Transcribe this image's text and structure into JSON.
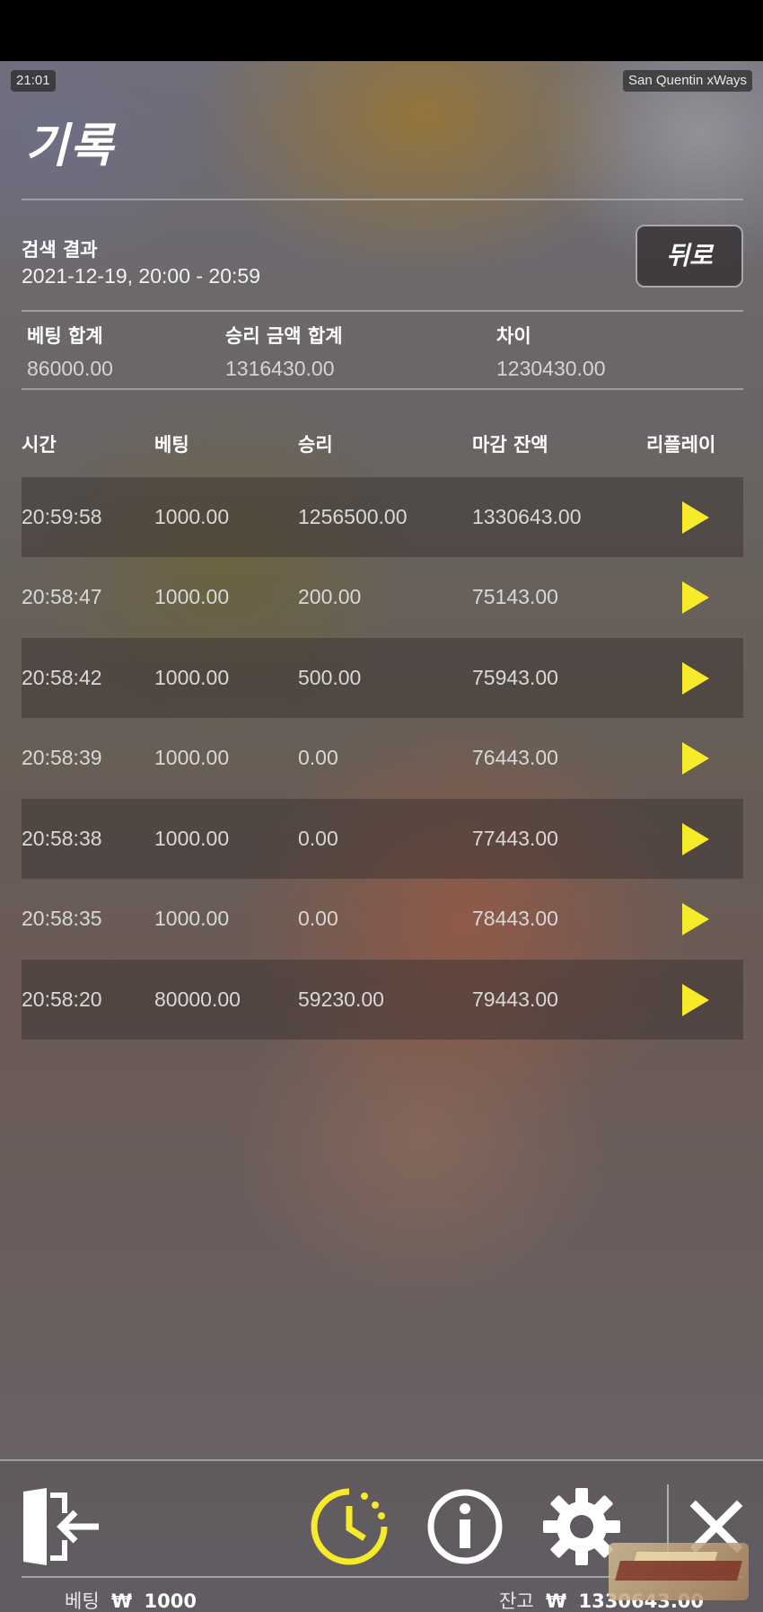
{
  "status_bar": {
    "time": "21:01",
    "game_name": "San Quentin xWays"
  },
  "page": {
    "title": "기록",
    "back_label": "뒤로"
  },
  "search": {
    "label": "검색 결과",
    "range": "2021-12-19, 20:00 - 20:59"
  },
  "summary": {
    "bet_total_label": "베팅 합계",
    "bet_total_value": "86000.00",
    "win_total_label": "승리 금액 합계",
    "win_total_value": "1316430.00",
    "diff_label": "차이",
    "diff_value": "1230430.00"
  },
  "table": {
    "headers": {
      "time": "시간",
      "bet": "베팅",
      "win": "승리",
      "closing_balance": "마감 잔액",
      "replay": "리플레이"
    },
    "rows": [
      {
        "time": "20:59:58",
        "bet": "1000.00",
        "win": "1256500.00",
        "balance": "1330643.00"
      },
      {
        "time": "20:58:47",
        "bet": "1000.00",
        "win": "200.00",
        "balance": "75143.00"
      },
      {
        "time": "20:58:42",
        "bet": "1000.00",
        "win": "500.00",
        "balance": "75943.00"
      },
      {
        "time": "20:58:39",
        "bet": "1000.00",
        "win": "0.00",
        "balance": "76443.00"
      },
      {
        "time": "20:58:38",
        "bet": "1000.00",
        "win": "0.00",
        "balance": "77443.00"
      },
      {
        "time": "20:58:35",
        "bet": "1000.00",
        "win": "0.00",
        "balance": "78443.00"
      },
      {
        "time": "20:58:20",
        "bet": "80000.00",
        "win": "59230.00",
        "balance": "79443.00"
      }
    ]
  },
  "footer": {
    "bet_label": "베팅",
    "bet_currency": "₩",
    "bet_value": "1000",
    "balance_label": "잔고",
    "balance_currency": "₩",
    "balance_value": "1330643.00",
    "icons": [
      "exit-icon",
      "history-icon",
      "info-icon",
      "settings-icon",
      "close-icon"
    ]
  },
  "colors": {
    "accent_yellow": "#f7ea2a",
    "white": "#ffffff"
  }
}
